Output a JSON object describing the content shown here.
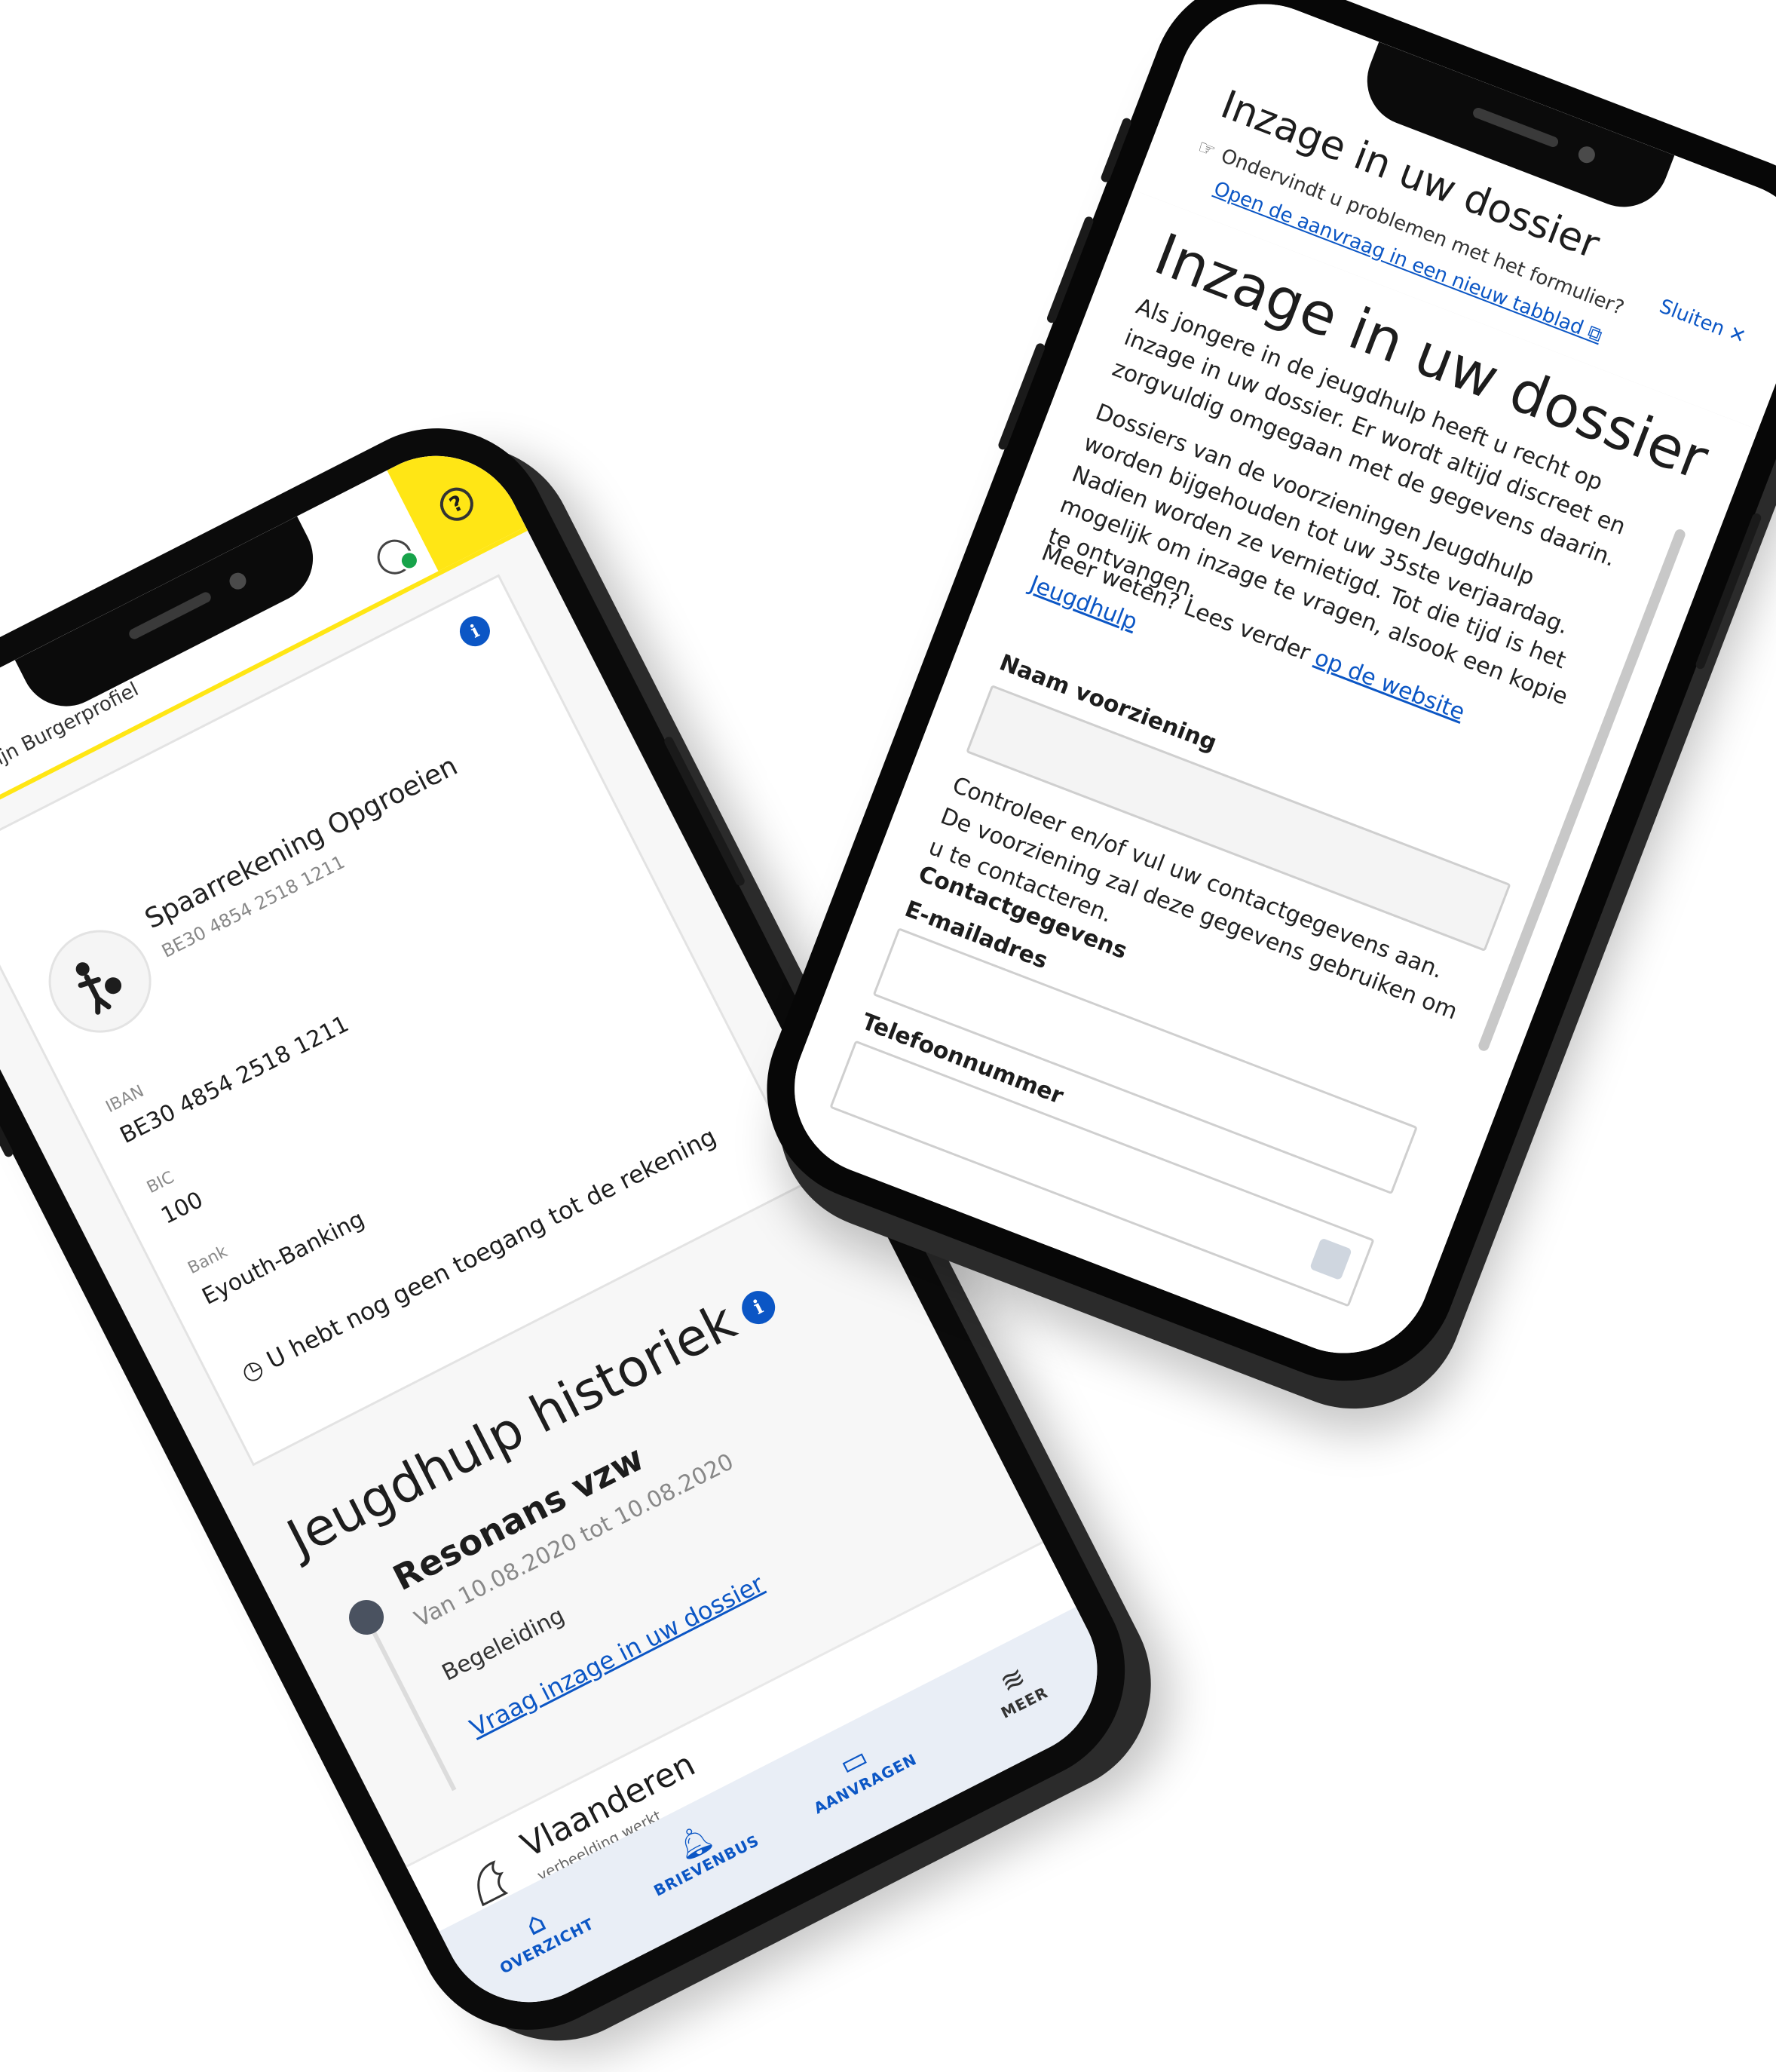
{
  "left_phone": {
    "header": {
      "breadcrumb": "Mijn Burgerprofiel",
      "help_icon": "question-circle-icon",
      "accent_color": "#ffe615"
    },
    "account_card": {
      "name": "Spaarrekening Opgroeien",
      "number": "BE30 4854 2518 1211",
      "iban_label": "IBAN",
      "iban_value": "BE30 4854 2518 1211",
      "bic_label": "BIC",
      "bic_value": "100",
      "bank_label": "Bank",
      "bank_value": "Eyouth-Banking",
      "notice": "U hebt nog geen toegang tot de rekening"
    },
    "history": {
      "title": "Jeugdhulp historiek",
      "items": [
        {
          "name": "Resonans vzw",
          "dates": "Van 10.08.2020 tot 10.08.2020",
          "type": "Begeleiding",
          "link": "Vraag inzage in uw dossier"
        }
      ]
    },
    "footer": {
      "brand": "Vlaanderen",
      "tagline": "verbeelding werkt"
    },
    "nav": [
      {
        "label": "OVERZICHT",
        "icon": "home-icon"
      },
      {
        "label": "BRIEVENBUS",
        "icon": "bell-icon"
      },
      {
        "label": "AANVRAGEN",
        "icon": "folder-icon"
      },
      {
        "label": "MEER",
        "icon": "layers-icon"
      }
    ],
    "link_color": "#0b56c5"
  },
  "right_phone": {
    "header": {
      "title": "Inzage in uw dossier",
      "close_label": "Sluiten ✕",
      "problem_text": "Ondervindt u problemen met het formulier?",
      "newtab_link": "Open de aanvraag in een nieuw tabblad ⧉"
    },
    "body": {
      "title": "Inzage in uw dossier",
      "p1": "Als jongere in de jeugdhulp heeft u recht op inzage in uw dossier. Er wordt altijd discreet en zorgvuldig omgegaan met de gegevens daarin.",
      "p2": "Dossiers van de voorzieningen Jeugdhulp worden bijgehouden tot uw 35ste verjaardag. Nadien worden ze vernietigd. Tot die tijd is het mogelijk om inzage te vragen, alsook een kopie te ontvangen.",
      "p3_prefix": "Meer weten? Lees verder",
      "p3_link1": "op de website Jeugdhulp",
      "field1_label": "Naam voorziening",
      "p4": "Controleer en/of vul uw contactgegevens aan. De voorziening zal deze gegevens gebruiken om u te contacteren.",
      "contact_heading": "Contactgegevens",
      "email_label": "E-mailadres",
      "phone_label": "Telefoonnummer"
    }
  }
}
